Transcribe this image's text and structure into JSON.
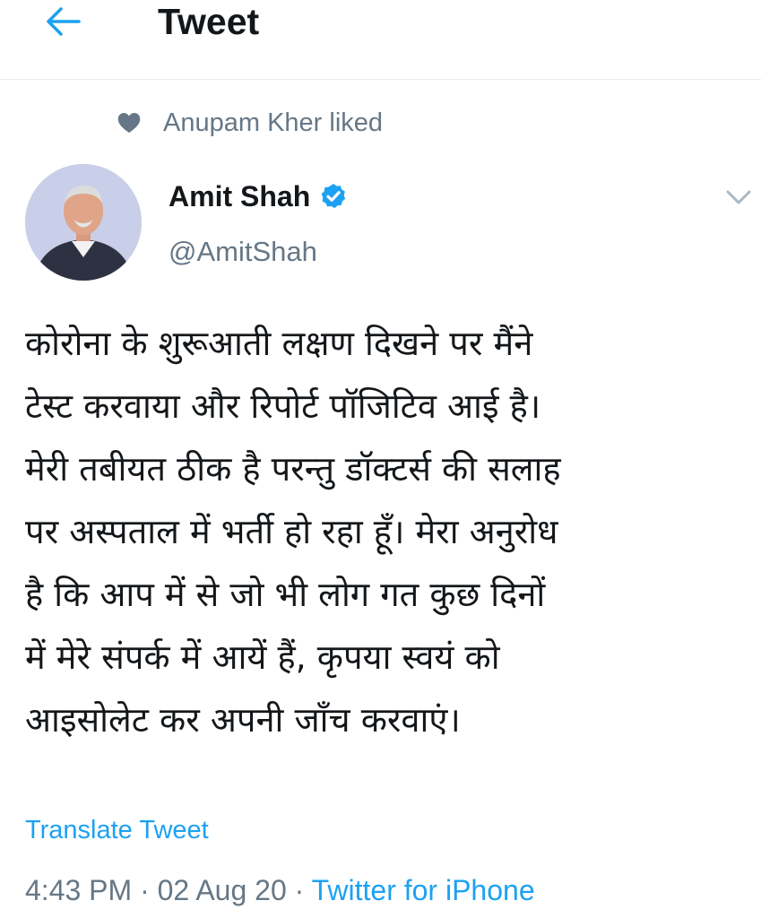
{
  "header": {
    "title": "Tweet",
    "back_icon": "arrow-left-icon"
  },
  "social_context": {
    "icon": "heart-icon",
    "text": "Anupam Kher liked"
  },
  "author": {
    "name": "Amit Shah",
    "handle": "@AmitShah",
    "verified_icon": "verified-badge-icon"
  },
  "tweet": {
    "text": "कोरोना के शुरूआती लक्षण दिखने पर मैंने\nटेस्ट करवाया और रिपोर्ट पॉजिटिव आई है।\nमेरी तबीयत ठीक है परन्तु डॉक्टर्स की सलाह\nपर अस्पताल में भर्ती हो रहा हूँ। मेरा अनुरोध\nहै कि आप में से जो भी लोग गत कुछ दिनों\nमें मेरे संपर्क में आयें हैं, कृपया स्वयं को\nआइसोलेट कर अपनी जाँच करवाएं।",
    "translate_label": "Translate Tweet",
    "time": "4:43 PM",
    "separator": "·",
    "date": "02 Aug 20",
    "source": "Twitter for iPhone"
  },
  "colors": {
    "accent": "#1da1f2",
    "secondary_text": "#657786",
    "primary_text": "#14171a"
  }
}
